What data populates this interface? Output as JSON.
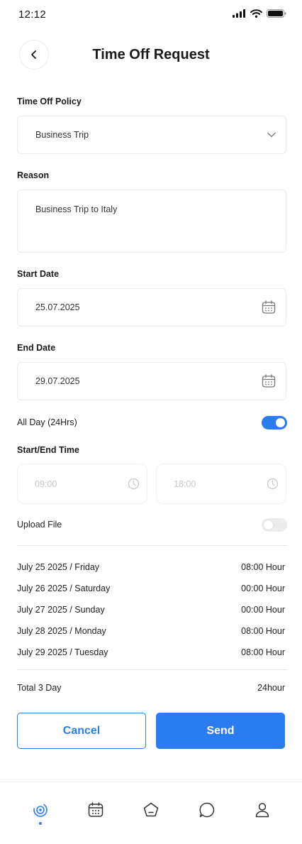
{
  "status": {
    "time": "12:12"
  },
  "header": {
    "title": "Time Off Request"
  },
  "policy": {
    "label": "Time Off Policy",
    "value": "Business Trip"
  },
  "reason": {
    "label": "Reason",
    "value": "Business Trip to Italy"
  },
  "start_date": {
    "label": "Start Date",
    "value": "25.07.2025"
  },
  "end_date": {
    "label": "End Date",
    "value": "29.07.2025"
  },
  "all_day": {
    "label": "All Day (24Hrs)",
    "enabled": true
  },
  "time": {
    "label": "Start/End Time",
    "start": "09:00",
    "end": "18:00"
  },
  "upload": {
    "label": "Upload File",
    "enabled": false
  },
  "days": [
    {
      "date": "July 25 2025 / Friday",
      "hours": "08:00 Hour"
    },
    {
      "date": "July 26 2025 / Saturday",
      "hours": "00:00 Hour"
    },
    {
      "date": "July 27 2025 / Sunday",
      "hours": "00:00 Hour"
    },
    {
      "date": "July 28 2025 / Monday",
      "hours": "08:00 Hour"
    },
    {
      "date": "July 29 2025 / Tuesday",
      "hours": "08:00 Hour"
    }
  ],
  "total": {
    "label": "Total 3 Day",
    "value": "24hour"
  },
  "actions": {
    "cancel": "Cancel",
    "send": "Send"
  },
  "nav": {
    "items": [
      "home-icon",
      "calendar-icon",
      "pentagon-icon",
      "chat-icon",
      "profile-icon"
    ],
    "active": "home-icon"
  },
  "colors": {
    "accent": "#2b7cf0",
    "border": "#ececec",
    "muted": "#c7c7c7"
  }
}
